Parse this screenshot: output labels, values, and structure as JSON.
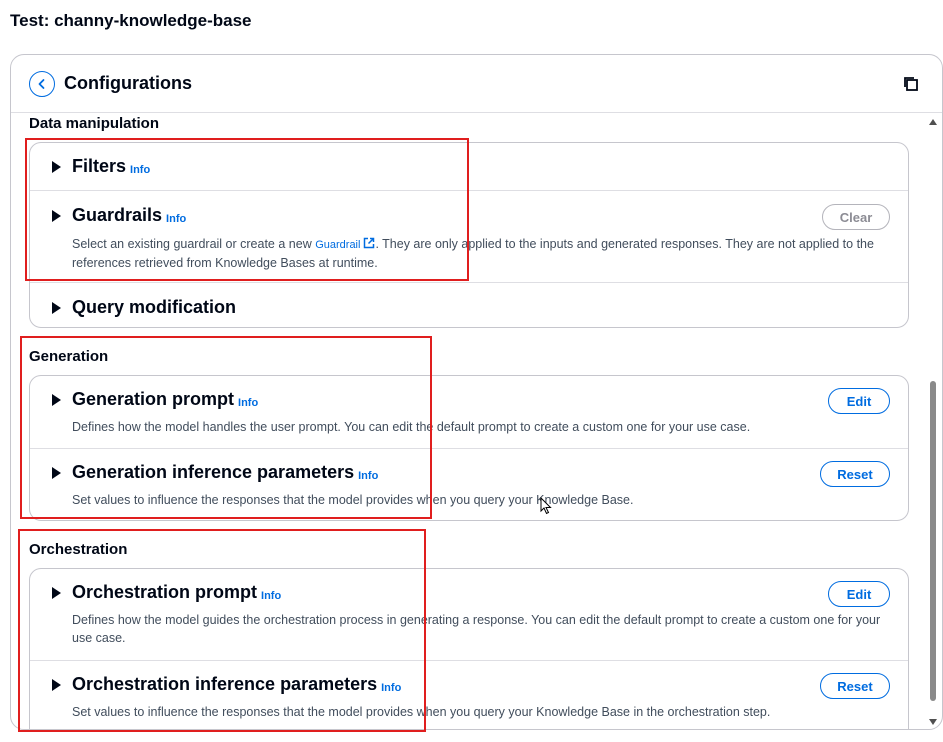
{
  "page_title": "Test: channy-knowledge-base",
  "panel": {
    "title": "Configurations"
  },
  "sections": {
    "data_manipulation": {
      "label": "Data manipulation",
      "filters": {
        "title": "Filters",
        "info": "Info"
      },
      "guardrails": {
        "title": "Guardrails",
        "info": "Info",
        "clear_label": "Clear",
        "desc_before": "Select an existing guardrail or create a new ",
        "desc_link": "Guardrail",
        "desc_after": ". They are only applied to the inputs and generated responses. They are not applied to the references retrieved from Knowledge Bases at runtime."
      },
      "query_modification": {
        "title": "Query modification"
      }
    },
    "generation": {
      "label": "Generation",
      "prompt": {
        "title": "Generation prompt",
        "info": "Info",
        "button": "Edit",
        "desc": "Defines how the model handles the user prompt. You can edit the default prompt to create a custom one for your use case."
      },
      "inference": {
        "title": "Generation inference parameters",
        "info": "Info",
        "button": "Reset",
        "desc": "Set values to influence the responses that the model provides when you query your Knowledge Base."
      }
    },
    "orchestration": {
      "label": "Orchestration",
      "prompt": {
        "title": "Orchestration prompt",
        "info": "Info",
        "button": "Edit",
        "desc": "Defines how the model guides the orchestration process in generating a response. You can edit the default prompt to create a custom one for your use case."
      },
      "inference": {
        "title": "Orchestration inference parameters",
        "info": "Info",
        "button": "Reset",
        "desc": "Set values to influence the responses that the model provides when you query your Knowledge Base in the orchestration step."
      }
    }
  },
  "icons": {
    "back": "chevron-left-icon",
    "copy": "copy-icon",
    "external": "external-link-icon",
    "caret": "caret-right-icon"
  },
  "colors": {
    "accent": "#006ce0",
    "highlight_box": "#e01e1e",
    "text": "#000716",
    "secondary_text": "#414d5c"
  }
}
